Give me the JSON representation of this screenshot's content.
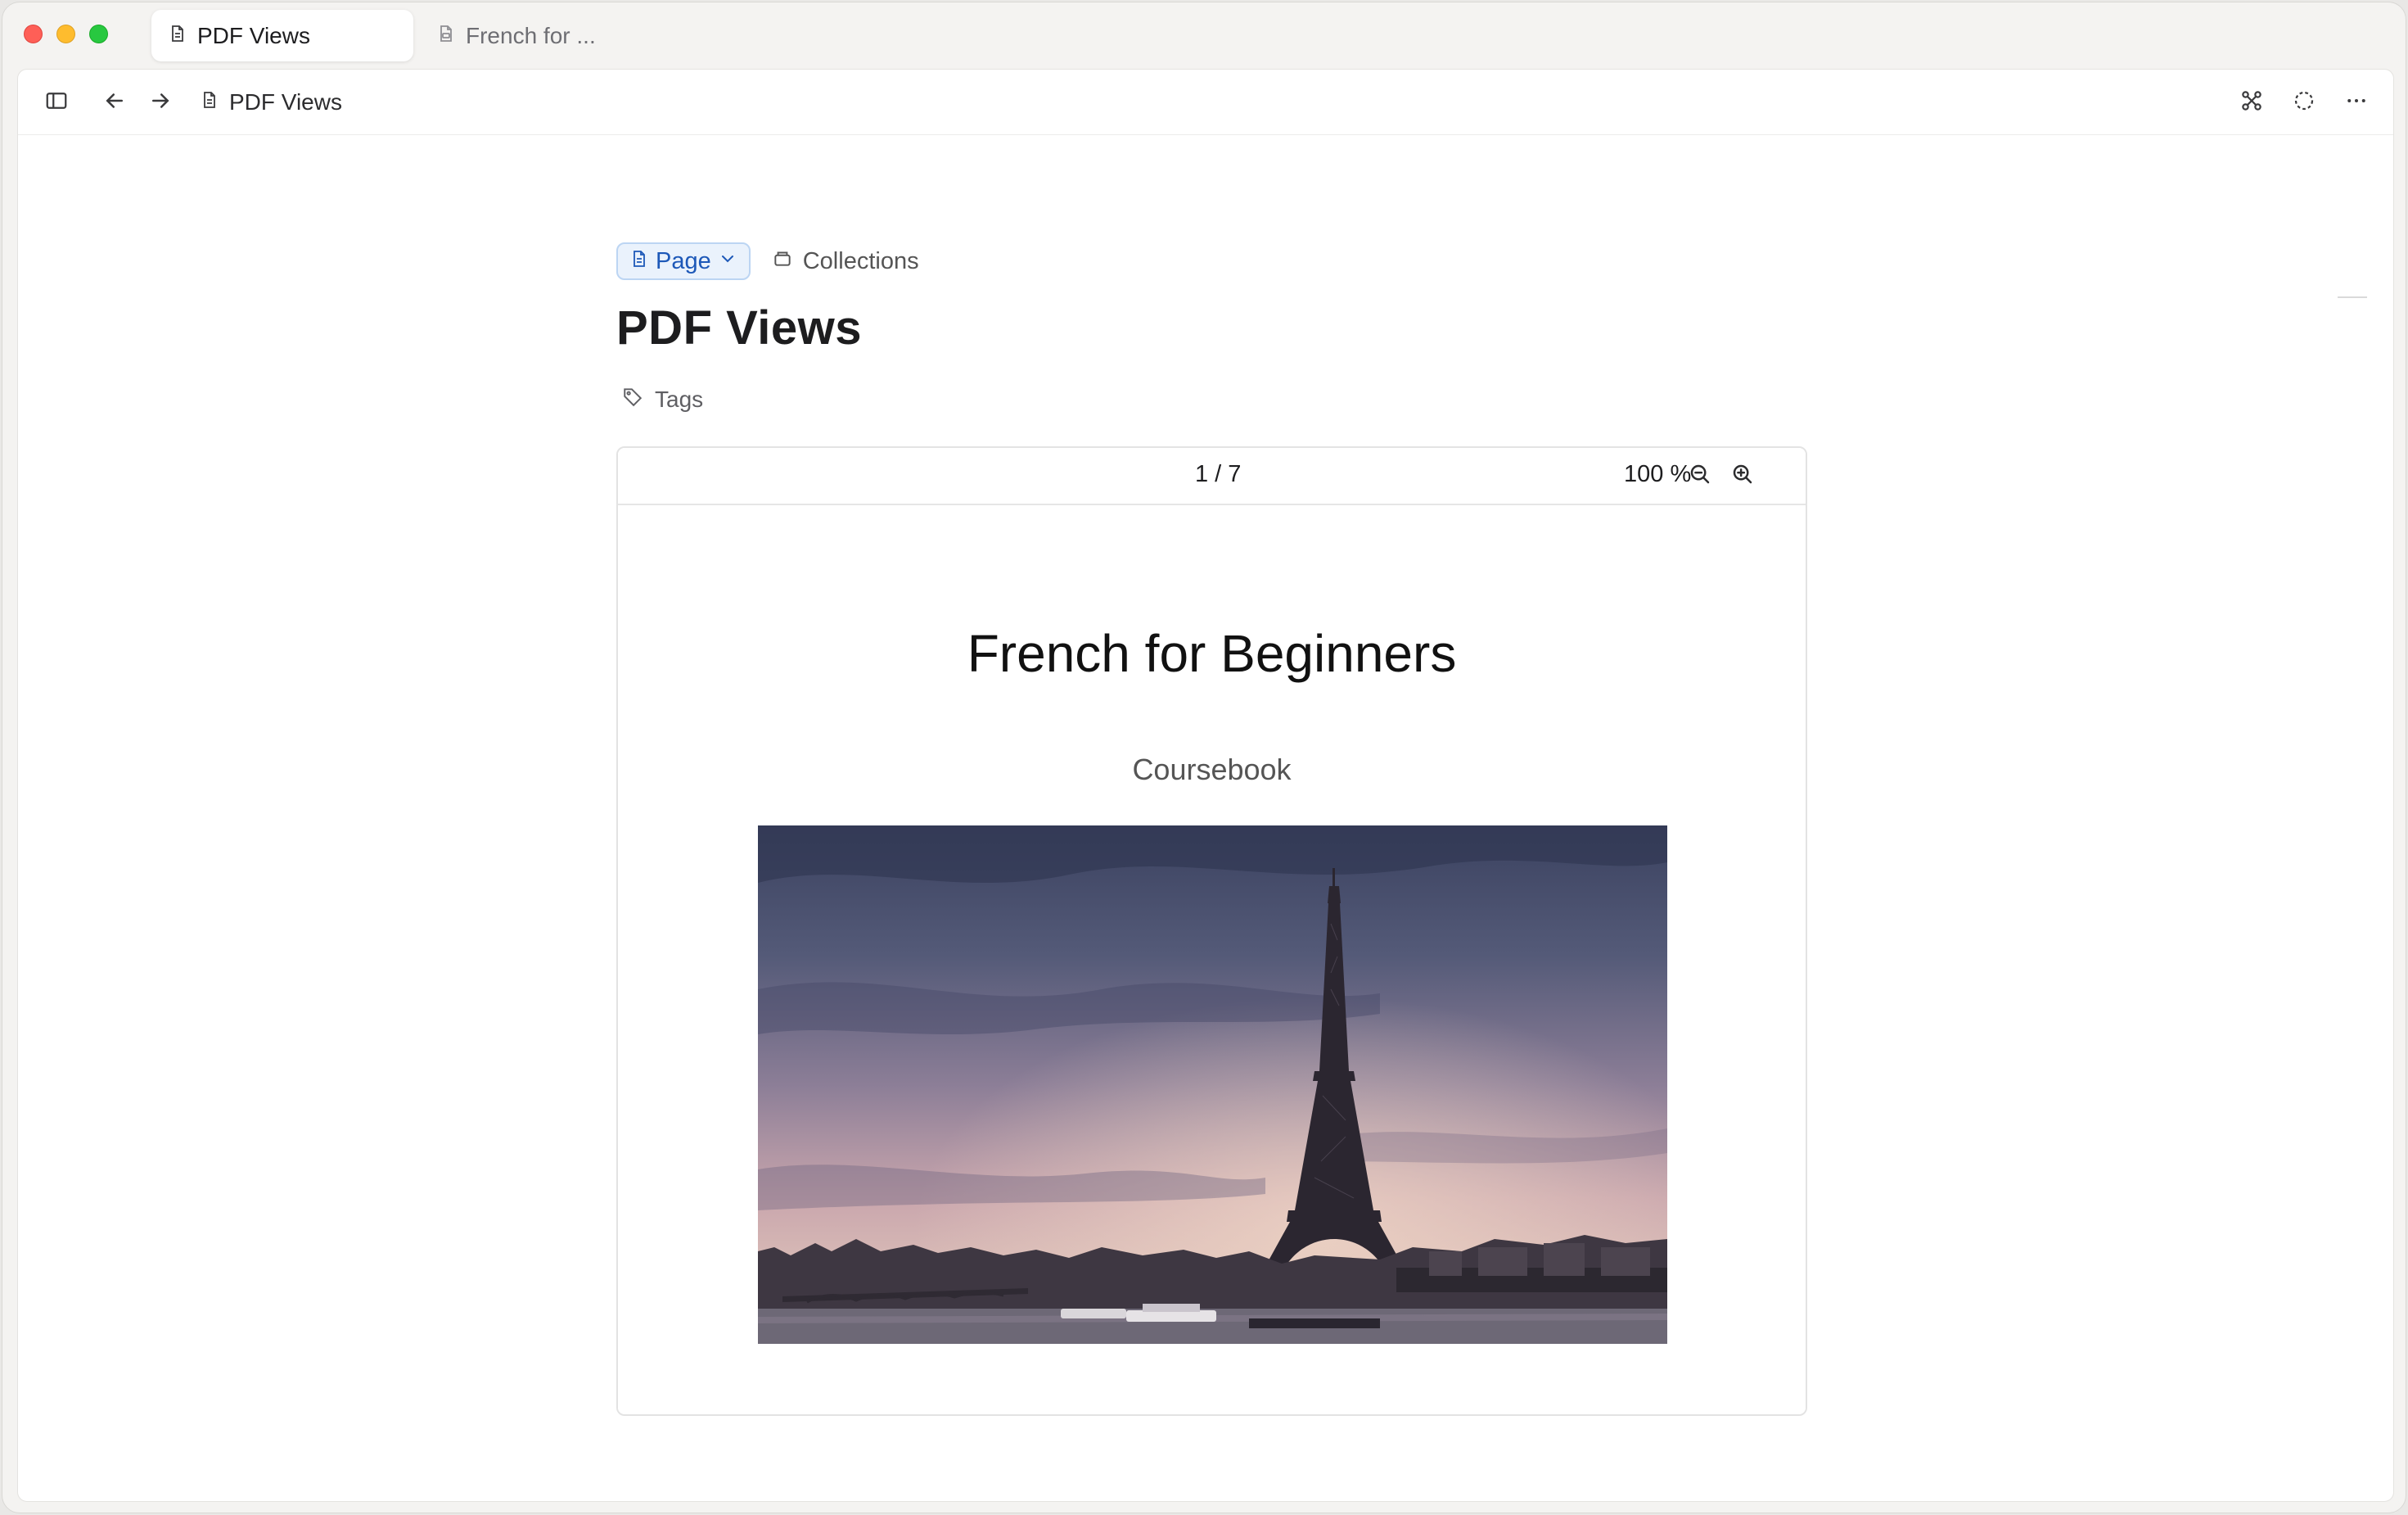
{
  "window": {
    "tabs": [
      {
        "label": "PDF Views",
        "active": true
      },
      {
        "label": "French for ...",
        "active": false
      }
    ]
  },
  "toolbar": {
    "breadcrumb": "PDF Views",
    "icons": [
      "sidebar-toggle-icon",
      "back-arrow-icon",
      "forward-arrow-icon",
      "graph-icon",
      "sync-icon",
      "more-icon"
    ]
  },
  "header": {
    "type_label": "Page",
    "collections_label": "Collections",
    "title": "PDF Views",
    "tags_label": "Tags"
  },
  "pdf_viewer": {
    "page_indicator": "1 / 7",
    "zoom": "100 %",
    "document": {
      "title": "French for Beginners",
      "subtitle": "Coursebook",
      "image": "Eiffel Tower at dusk over the Seine"
    }
  },
  "footer": {
    "shortcut_icon": "⌘"
  },
  "colors": {
    "accent": "#1d58b8",
    "accent_bg": "#eaf2fc"
  }
}
